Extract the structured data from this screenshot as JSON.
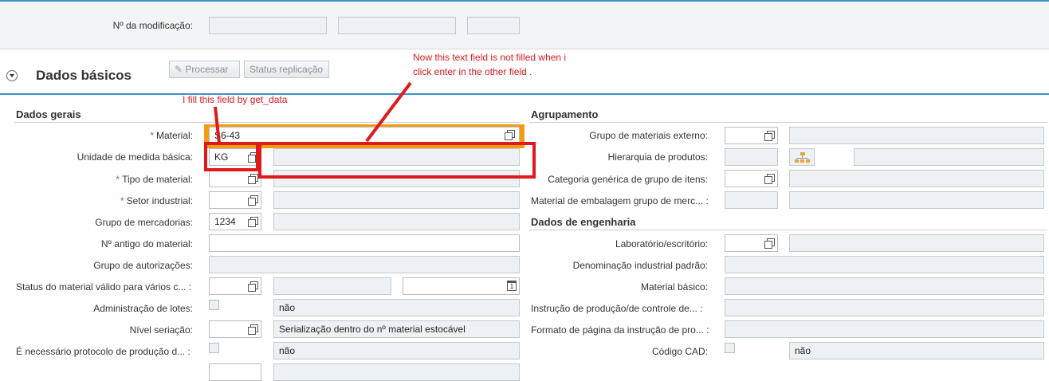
{
  "header": {
    "modification_label": "Nº da modificação:"
  },
  "section": {
    "title": "Dados básicos",
    "process_button": "Processar",
    "replication_button": "Status replicação"
  },
  "annotations": {
    "note_top_line1": "Now this text field is not filled when i",
    "note_top_line2": "click enter in the other field .",
    "note_left": "I fill this field by get_data"
  },
  "left": {
    "group_title": "Dados gerais",
    "fields": {
      "material": {
        "label": "Material:",
        "value": "S6-43"
      },
      "unidade": {
        "label": "Unidade de medida básica:",
        "value": "KG"
      },
      "tipo": {
        "label": "Tipo de material:"
      },
      "setor": {
        "label": "Setor industrial:"
      },
      "grupo_merc": {
        "label": "Grupo de mercadorias:",
        "value": "1234"
      },
      "antigo": {
        "label": "Nº antigo do material:"
      },
      "autoriz": {
        "label": "Grupo de autorizações:"
      },
      "status": {
        "label": "Status do material válido para vários c... :"
      },
      "lotes": {
        "label": "Administração de lotes:",
        "value": "não"
      },
      "seriacao": {
        "label": "Nível seriação:",
        "value": "Serialização dentro do nº material estocável"
      },
      "protocolo": {
        "label": "É necessário protocolo de produção d... :",
        "value": "não"
      }
    }
  },
  "right": {
    "group_title": "Agrupamento",
    "fields": {
      "grupo_ext": {
        "label": "Grupo de materiais externo:"
      },
      "hierarquia": {
        "label": "Hierarquia de produtos:"
      },
      "categoria": {
        "label": "Categoria genérica de grupo de itens:"
      },
      "embalagem": {
        "label": "Material de embalagem grupo de merc... :"
      }
    },
    "eng_title": "Dados de engenharia",
    "eng": {
      "laboratorio": {
        "label": "Laboratório/escritório:"
      },
      "denominacao": {
        "label": "Denominação industrial padrão:"
      },
      "basico": {
        "label": "Material básico:"
      },
      "instrucao": {
        "label": "Instrução de produção/de controle de... :"
      },
      "formato": {
        "label": "Formato de página da instrução de pro... :"
      },
      "cad": {
        "label": "Código CAD:",
        "value": "não"
      }
    }
  },
  "colors": {
    "accent": "#3f8fc9",
    "annotation": "#e0191c",
    "highlight": "#f39c12"
  }
}
